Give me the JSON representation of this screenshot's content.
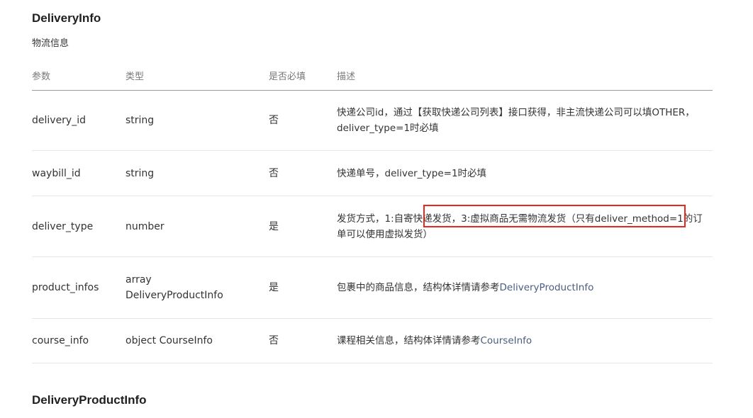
{
  "section": {
    "title": "DeliveryInfo",
    "subtitle": "物流信息"
  },
  "table": {
    "headers": [
      "参数",
      "类型",
      "是否必填",
      "描述"
    ],
    "rows": [
      {
        "param": "delivery_id",
        "type": "string",
        "required": "否",
        "desc_line1": "快递公司id，通过【获取快递公司列表】接口获得，非主流快递公司可以填OTHER，",
        "desc_line2": "deliver_type=1时必填"
      },
      {
        "param": "waybill_id",
        "type": "string",
        "required": "否",
        "desc": "快递单号，deliver_type=1时必填"
      },
      {
        "param": "deliver_type",
        "type": "number",
        "required": "是",
        "desc_line1": "发货方式，1:自寄快递发货，3:虚拟商品无需物流发货（只有deliver_method=1的订",
        "desc_line2": "单可以使用虚拟发货）"
      },
      {
        "param": "product_infos",
        "type_line1": "array",
        "type_line2": "DeliveryProductInfo",
        "required": "是",
        "desc_prefix": "包裹中的商品信息，结构体详情请参考",
        "desc_link": "DeliveryProductInfo"
      },
      {
        "param": "course_info",
        "type": "object CourseInfo",
        "required": "否",
        "desc_prefix": "课程相关信息，结构体详情请参考",
        "desc_link": "CourseInfo"
      }
    ]
  },
  "next_section": {
    "title": "DeliveryProductInfo"
  },
  "colors": {
    "link": "#4a5d7e",
    "highlight": "#e8271e",
    "header_text": "#7a7a7a",
    "divider": "#e6e6e6"
  }
}
